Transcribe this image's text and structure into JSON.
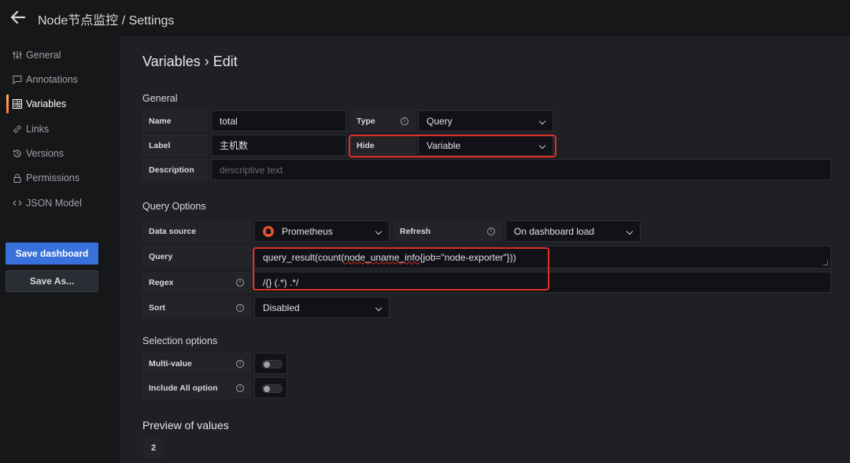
{
  "window": {
    "title": "Node节点监控 / Settings"
  },
  "sidebar": {
    "items": [
      {
        "label": "General",
        "icon": "sliders-icon"
      },
      {
        "label": "Annotations",
        "icon": "comment-icon"
      },
      {
        "label": "Variables",
        "icon": "calculator-icon",
        "active": true
      },
      {
        "label": "Links",
        "icon": "link-icon"
      },
      {
        "label": "Versions",
        "icon": "history-icon"
      },
      {
        "label": "Permissions",
        "icon": "lock-icon"
      },
      {
        "label": "JSON Model",
        "icon": "code-icon"
      }
    ],
    "save_label": "Save dashboard",
    "save_as_label": "Save As..."
  },
  "page": {
    "title": "Variables › Edit"
  },
  "general": {
    "heading": "General",
    "name_label": "Name",
    "name_value": "total",
    "type_label": "Type",
    "type_value": "Query",
    "label_label": "Label",
    "label_value": "主机数",
    "hide_label": "Hide",
    "hide_value": "Variable",
    "description_label": "Description",
    "description_placeholder": "descriptive text"
  },
  "query_options": {
    "heading": "Query Options",
    "datasource_label": "Data source",
    "datasource_value": "Prometheus",
    "refresh_label": "Refresh",
    "refresh_value": "On dashboard load",
    "query_label": "Query",
    "query_value_prefix": "query_result(count(",
    "query_value_squiggle": "node_uname_info",
    "query_value_suffix": "{job=\"node-exporter\"}))",
    "regex_label": "Regex",
    "regex_value": "/{} (.*) .*/",
    "sort_label": "Sort",
    "sort_value": "Disabled"
  },
  "selection_options": {
    "heading": "Selection options",
    "multi_value_label": "Multi-value",
    "multi_value_on": false,
    "include_all_label": "Include All option",
    "include_all_on": false
  },
  "preview": {
    "heading": "Preview of values",
    "values": [
      "2"
    ]
  },
  "colors": {
    "accent_primary": "#3871dc",
    "highlight_red": "#e02f26",
    "active_indicator": "#ff7941"
  }
}
